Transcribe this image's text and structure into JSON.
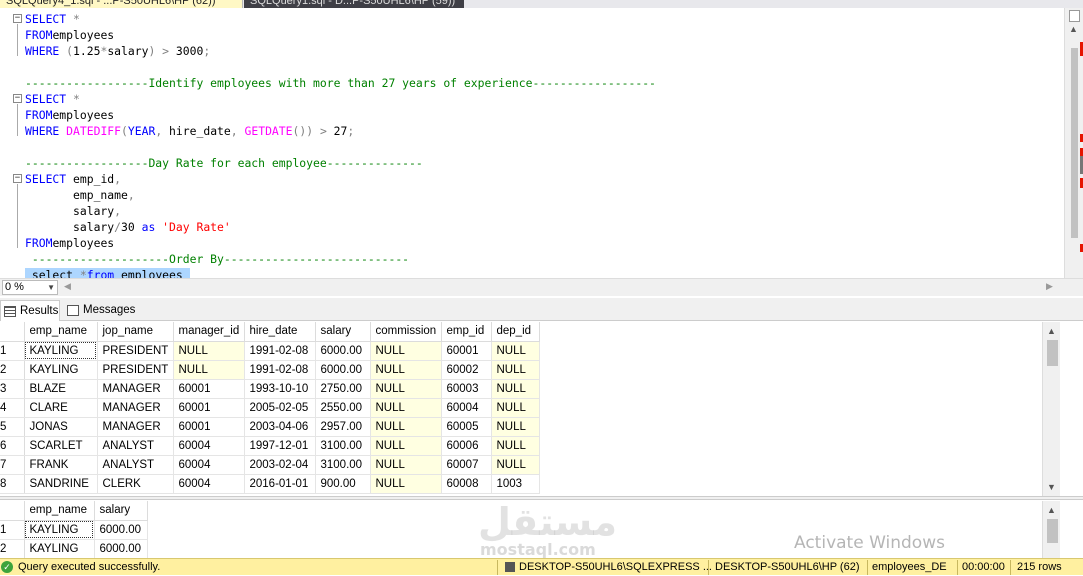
{
  "tabs": [
    {
      "label": "SQLQuery4_1.sql - ...P-S50UHL6\\HP (62))",
      "active": true
    },
    {
      "label": "SQLQuery1.sql - D...P-S50UHL6\\HP (59))",
      "active": false
    }
  ],
  "editor": {
    "lines": [
      {
        "parts": [
          [
            "kw",
            "SELECT "
          ],
          [
            "op",
            "*"
          ]
        ]
      },
      {
        "parts": [
          [
            "kw",
            "FROM"
          ],
          [
            "",
            "employees"
          ]
        ]
      },
      {
        "parts": [
          [
            "kw",
            "WHERE "
          ],
          [
            "op",
            "("
          ],
          [
            "",
            "1.25"
          ],
          [
            "op",
            "*"
          ],
          [
            "",
            "salary"
          ],
          [
            "op",
            ")"
          ],
          [
            "op",
            " > "
          ],
          [
            "",
            "3000"
          ],
          [
            "op",
            ";"
          ]
        ]
      },
      {
        "parts": []
      },
      {
        "parts": [
          [
            "cm",
            "------------------Identify employees with more than 27 years of experience------------------"
          ]
        ]
      },
      {
        "parts": [
          [
            "kw",
            "SELECT "
          ],
          [
            "op",
            "*"
          ]
        ]
      },
      {
        "parts": [
          [
            "kw",
            "FROM"
          ],
          [
            "",
            "employees"
          ]
        ]
      },
      {
        "parts": [
          [
            "kw",
            "WHERE "
          ],
          [
            "fn",
            "DATEDIFF"
          ],
          [
            "op",
            "("
          ],
          [
            "kw",
            "YEAR"
          ],
          [
            "op",
            ", "
          ],
          [
            "",
            "hire_date"
          ],
          [
            "op",
            ", "
          ],
          [
            "fn",
            "GETDATE"
          ],
          [
            "op",
            "())"
          ],
          [
            "op",
            " > "
          ],
          [
            "",
            "27"
          ],
          [
            "op",
            ";"
          ]
        ]
      },
      {
        "parts": []
      },
      {
        "parts": [
          [
            "cm",
            "------------------Day Rate for each employee--------------"
          ]
        ]
      },
      {
        "parts": [
          [
            "kw",
            "SELECT "
          ],
          [
            "",
            "emp_id"
          ],
          [
            "op",
            ","
          ]
        ]
      },
      {
        "parts": [
          [
            "",
            "       emp_name"
          ],
          [
            "op",
            ","
          ]
        ]
      },
      {
        "parts": [
          [
            "",
            "       salary"
          ],
          [
            "op",
            ","
          ]
        ]
      },
      {
        "parts": [
          [
            "",
            "       salary"
          ],
          [
            "op",
            "/"
          ],
          [
            "",
            "30 "
          ],
          [
            "kw",
            "as "
          ],
          [
            "str",
            "'Day Rate'"
          ]
        ]
      },
      {
        "parts": [
          [
            "kw",
            "FROM"
          ],
          [
            "",
            "employees"
          ]
        ]
      },
      {
        "parts": [
          [
            "cm",
            " --------------------Order By---------------------------"
          ]
        ]
      },
      {
        "parts": [
          [
            "sel",
            " select "
          ],
          [
            "selop",
            "*"
          ],
          [
            "selkw",
            "from"
          ],
          [
            "sel",
            " employees "
          ]
        ]
      }
    ]
  },
  "zoom": "0 %",
  "result_tabs": {
    "results": "Results",
    "messages": "Messages"
  },
  "grid1": {
    "columns": [
      "emp_name",
      "jop_name",
      "manager_id",
      "hire_date",
      "salary",
      "commission",
      "emp_id",
      "dep_id"
    ],
    "rows": [
      [
        "1",
        "KAYLING",
        "PRESIDENT",
        "NULL",
        "1991-02-08",
        "6000.00",
        "NULL",
        "60001",
        "NULL"
      ],
      [
        "2",
        "KAYLING",
        "PRESIDENT",
        "NULL",
        "1991-02-08",
        "6000.00",
        "NULL",
        "60002",
        "NULL"
      ],
      [
        "3",
        "BLAZE",
        "MANAGER",
        "60001",
        "1993-10-10",
        "2750.00",
        "NULL",
        "60003",
        "NULL"
      ],
      [
        "4",
        "CLARE",
        "MANAGER",
        "60001",
        "2005-02-05",
        "2550.00",
        "NULL",
        "60004",
        "NULL"
      ],
      [
        "5",
        "JONAS",
        "MANAGER",
        "60001",
        "2003-04-06",
        "2957.00",
        "NULL",
        "60005",
        "NULL"
      ],
      [
        "6",
        "SCARLET",
        "ANALYST",
        "60004",
        "1997-12-01",
        "3100.00",
        "NULL",
        "60006",
        "NULL"
      ],
      [
        "7",
        "FRANK",
        "ANALYST",
        "60004",
        "2003-02-04",
        "3100.00",
        "NULL",
        "60007",
        "NULL"
      ],
      [
        "8",
        "SANDRINE",
        "CLERK",
        "60004",
        "2016-01-01",
        "900.00",
        "NULL",
        "60008",
        "1003"
      ]
    ]
  },
  "grid2": {
    "columns": [
      "emp_name",
      "salary"
    ],
    "rows": [
      [
        "1",
        "KAYLING",
        "6000.00"
      ],
      [
        "2",
        "KAYLING",
        "6000.00"
      ]
    ]
  },
  "watermark": {
    "logo": "مستقل",
    "sub": "mostaql.com",
    "activate": "Activate Windows"
  },
  "status": {
    "message": "Query executed successfully.",
    "server": "DESKTOP-S50UHL6\\SQLEXPRESS ...",
    "user": "DESKTOP-S50UHL6\\HP (62)",
    "database": "employees_DE",
    "time": "00:00:00",
    "rows": "215 rows"
  },
  "colors": {
    "accent_status": "#fff0a0",
    "null_cell": "#ffffe1",
    "selection": "#add6ff",
    "keyword": "#0000ff",
    "function": "#ff00ff",
    "comment": "#008000",
    "string": "#ff0000"
  }
}
